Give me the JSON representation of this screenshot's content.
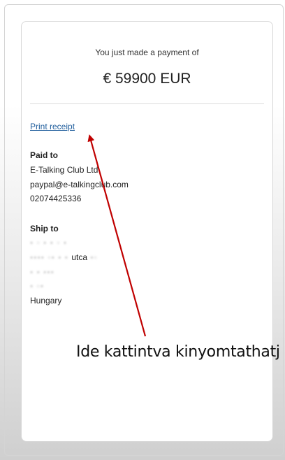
{
  "payment": {
    "intro": "You just made a payment of",
    "amount": "€ 59900 EUR"
  },
  "links": {
    "print_receipt": "Print receipt"
  },
  "paid_to": {
    "title": "Paid to",
    "name": "E-Talking Club Ltd",
    "email": "paypal@e-talkingclub.com",
    "phone": "02074425336"
  },
  "ship_to": {
    "title": "Ship to",
    "line2_suffix": "utca",
    "country": "Hungary"
  },
  "annotation": {
    "text": "Ide kattintva kinyomtathatj",
    "color": "#c00000"
  }
}
